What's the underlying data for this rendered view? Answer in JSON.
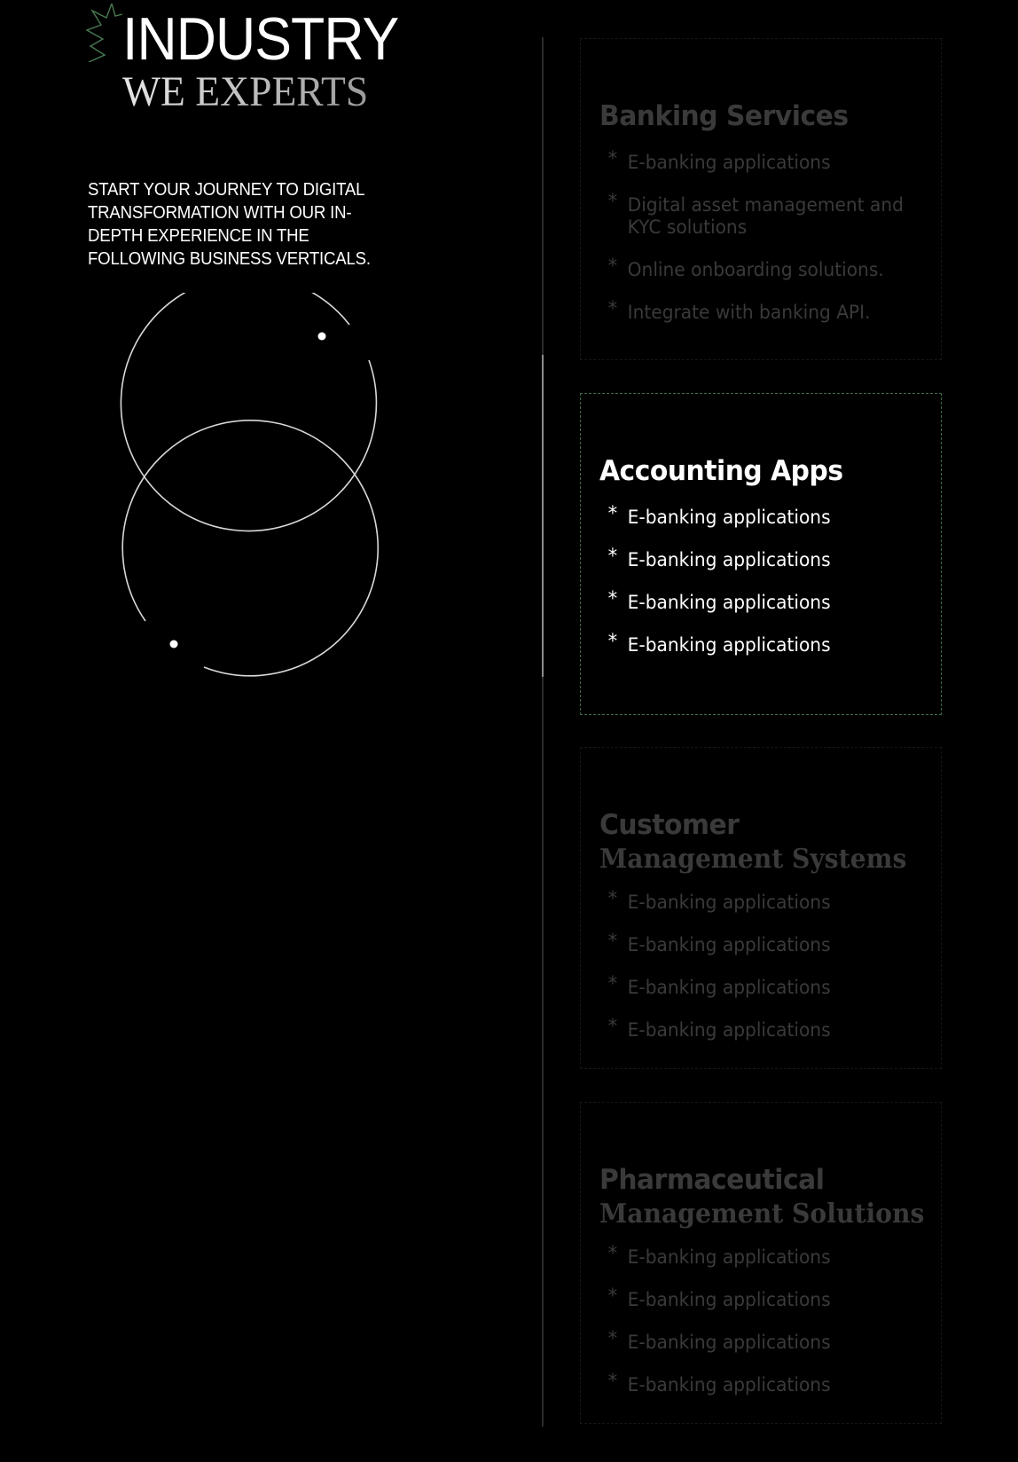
{
  "heading": {
    "line1": "INDUSTRY",
    "line2": "WE EXPERTS",
    "spark_icon": "spark-icon"
  },
  "intro": "START YOUR JOURNEY TO DIGITAL TRANSFORMATION WITH OUR IN-DEPTH EXPERIENCE IN THE FOLLOWING BUSINESS VERTICALS.",
  "colors": {
    "accent_green": "#3f6d45",
    "inactive_text": "#3a3a3a",
    "active_text": "#ffffff"
  },
  "cards": [
    {
      "title": "Banking Services",
      "title_serif": "",
      "active": false,
      "bullet": "*",
      "items": [
        "E-banking applications",
        "Digital asset management and KYC solutions",
        "Online onboarding solutions.",
        "Integrate with banking API."
      ]
    },
    {
      "title": "Accounting Apps",
      "title_serif": "",
      "active": true,
      "bullet": "*",
      "items": [
        "E-banking applications",
        "E-banking applications",
        "E-banking applications",
        "E-banking applications"
      ]
    },
    {
      "title": "Customer",
      "title_serif": "Management Systems",
      "active": false,
      "bullet": "*",
      "items": [
        "E-banking applications",
        "E-banking applications",
        "E-banking applications",
        "E-banking applications"
      ]
    },
    {
      "title": "Pharmaceutical",
      "title_serif": "Management Solutions",
      "active": false,
      "bullet": "*",
      "items": [
        "E-banking applications",
        "E-banking applications",
        "E-banking applications",
        "E-banking applications"
      ]
    }
  ]
}
